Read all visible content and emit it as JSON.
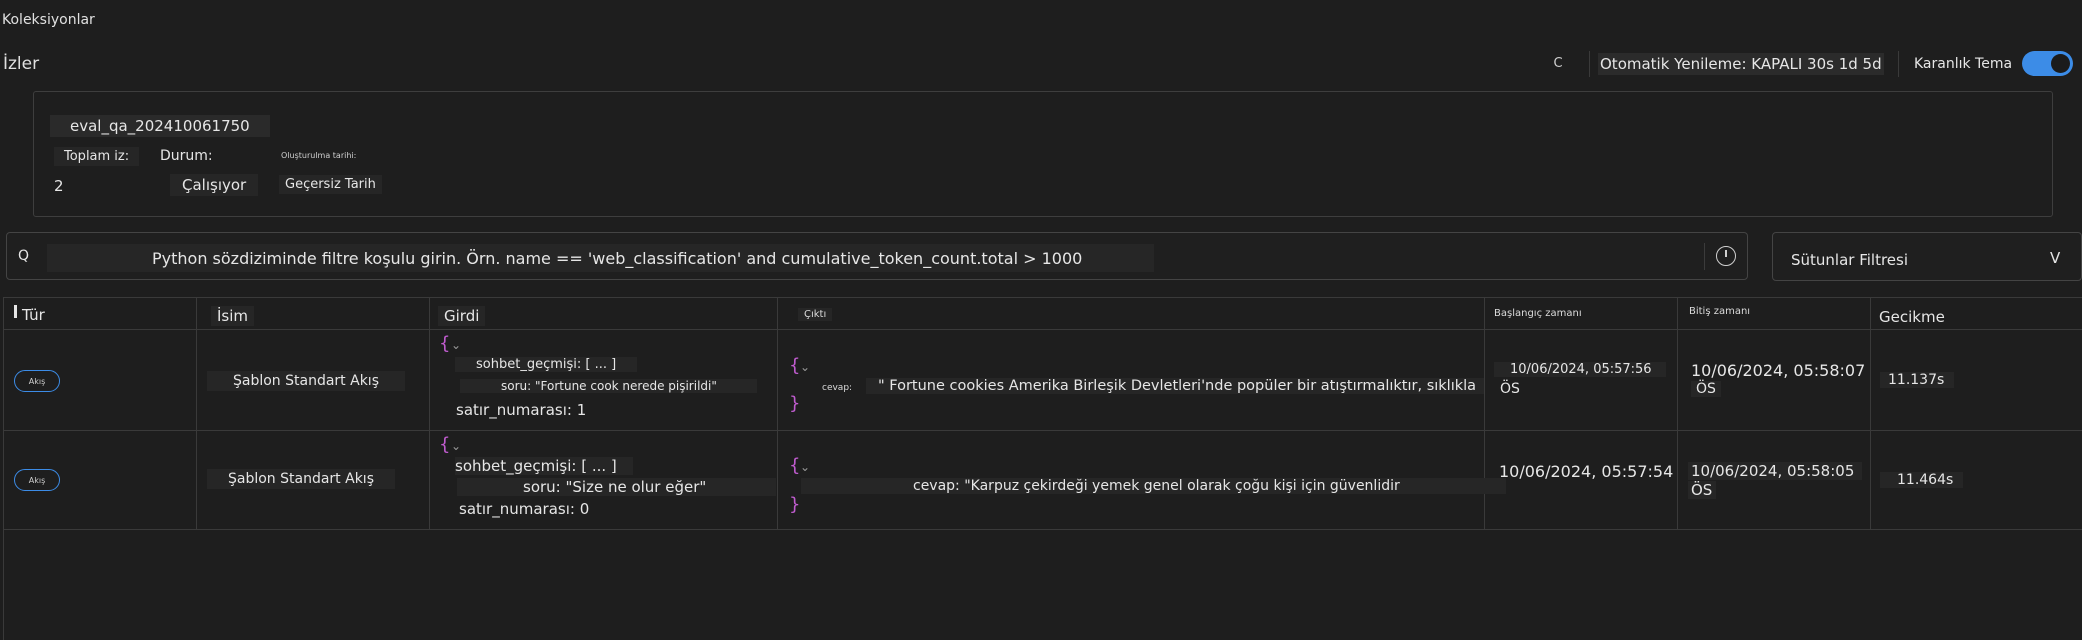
{
  "header": {
    "collections": "Koleksiyonlar",
    "title": "İzler",
    "refresh_icon_glyph": "C",
    "auto_refresh": "Otomatik Yenileme: KAPALI 30s 1d 5d",
    "dark_theme_label": "Karanlık Tema",
    "dark_theme_on": true
  },
  "run": {
    "name": "eval_qa_202410061750",
    "total_label": "Toplam iz:",
    "total_value": "2",
    "status_label": "Durum:",
    "status_value": "Çalışıyor",
    "created_label": "Oluşturulma tarihi:",
    "created_value": "Geçersiz Tarih"
  },
  "filter": {
    "icon_letter": "Q",
    "placeholder": "Python sözdiziminde filtre koşulu girin. Örn. name == 'web_classification' and cumulative_token_count.total > 1000",
    "columns_filter": "Sütunlar Filtresi",
    "chevron": "V"
  },
  "table": {
    "columns": {
      "type": "Tür",
      "name": "İsim",
      "input": "Girdi",
      "output": "Çıktı",
      "start": "Başlangıç zamanı",
      "end": "Bitiş zamanı",
      "latency": "Gecikme"
    },
    "rows": [
      {
        "type": "Akış",
        "name": "Şablon Standart Akış",
        "input_open": "{",
        "input_line1": "sohbet_geçmişi: [ ... ]",
        "input_line2": "soru: \"Fortune cook nerede pişirildi\"",
        "input_line3": "satır_numarası: 1",
        "output_open": "{",
        "output_key": "cevap:",
        "output_value": "\" Fortune cookies Amerika Birleşik Devletleri'nde popüler bir atıştırmalıktır, sıklıkla",
        "output_close": "}",
        "start": "10/06/2024, 05:57:56",
        "start_ampm": "ÖS",
        "end": "10/06/2024, 05:58:07",
        "end_ampm": "ÖS",
        "latency": "11.137s"
      },
      {
        "type": "Akış",
        "name": "Şablon Standart Akış",
        "input_open": "{",
        "input_line1": "sohbet_geçmişi: [ ... ]",
        "input_line2": "soru: \"Size ne olur eğer\"",
        "input_line3": "satır_numarası: 0",
        "output_open": "{",
        "output_key": "",
        "output_value": "cevap: \"Karpuz çekirdeği yemek genel olarak çoğu kişi için güvenlidir",
        "output_close": "}",
        "start": "10/06/2024, 05:57:54",
        "start_ampm": "",
        "end": "10/06/2024, 05:58:05",
        "end_ampm": "ÖS",
        "latency": "11.464s"
      }
    ]
  },
  "colors": {
    "accent": "#3c8ce7",
    "brace": "#c05ccf",
    "background": "#1e1e1e"
  }
}
